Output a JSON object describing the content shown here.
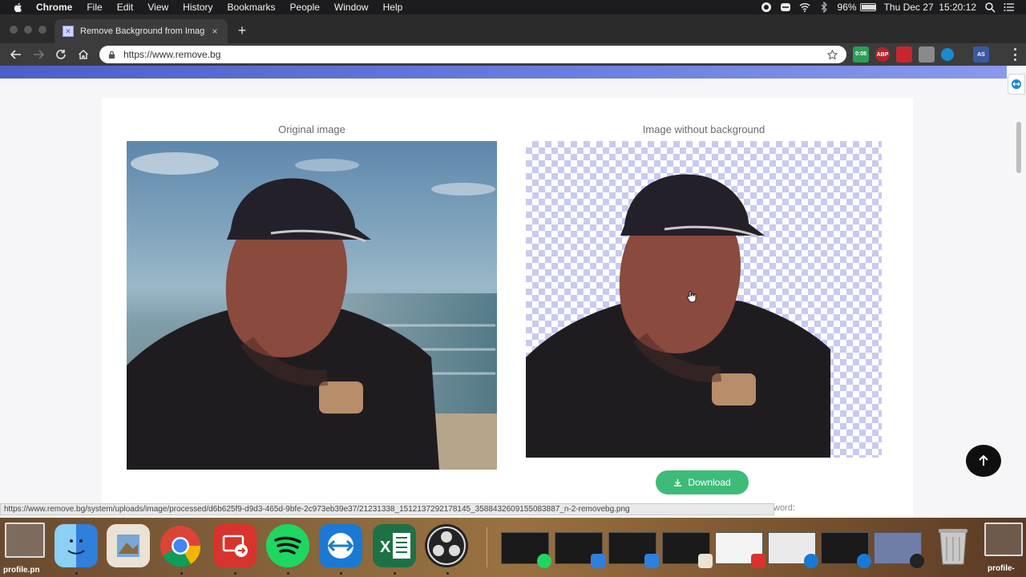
{
  "menubar": {
    "app_name": "Chrome",
    "items": [
      "File",
      "Edit",
      "View",
      "History",
      "Bookmarks",
      "People",
      "Window",
      "Help"
    ],
    "battery": "96%",
    "datetime": "Thu Dec 27  15:20:12"
  },
  "browser": {
    "tab_title": "Remove Background from Imag",
    "new_tab": "+",
    "tab_close": "×",
    "url": "https://www.remove.bg",
    "extension_timer": "0:08",
    "extension_abp": "ABP",
    "extension_as": "AS"
  },
  "page": {
    "original_title": "Original image",
    "result_title": "Image without background",
    "download_label": "Download",
    "partial_text": "word:",
    "colors": {
      "accent": "#3dbb78",
      "checker": "#c7cbf0",
      "hero": "#5a6bd6"
    }
  },
  "status_bar": {
    "url": "https://www.remove.bg/system/uploads/image/processed/d6b625f9-d9d3-465d-9bfe-2c973eb39e37/21231338_1512137292178145_3588432609155083887_n-2-removebg.png"
  },
  "dock": {
    "left_label": "profile.pn",
    "right_label": "profile-"
  }
}
